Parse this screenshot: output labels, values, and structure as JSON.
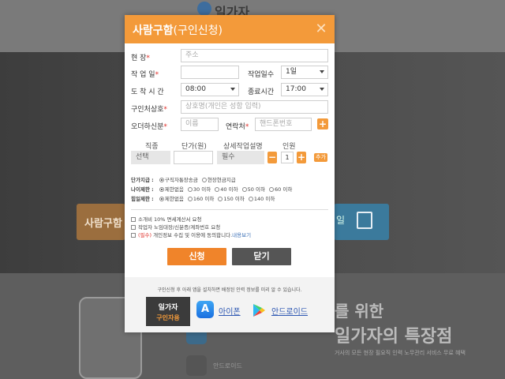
{
  "background": {
    "logo_text": "일가자",
    "left_button_text": "사람구함",
    "right_button_text": "일",
    "title_line1": "를 위한",
    "title_line2": "일가자의 특장점",
    "sub_text": "거사의 모든 현장 필요직 인력 노무관리 서비스 무료 혜택",
    "android_text": "안드로이드"
  },
  "modal": {
    "title_main": "사람구함",
    "title_paren": "(구인신청)",
    "fields": {
      "site_label": "현 장",
      "site_placeholder": "주소",
      "start_date_label": "작 업 일",
      "work_days_label": "작업일수",
      "work_days_value": "1일",
      "arrival_time_label": "도 착 시 간",
      "arrival_time_value": "08:00",
      "end_time_label": "종료시간",
      "end_time_value": "17:00",
      "company_label": "구인처상호",
      "company_placeholder": "상호명(개인은 성함 입력)",
      "contact_person_label": "오더하신분",
      "name_placeholder": "이름",
      "phone_label": "연락처",
      "phone_placeholder": "핸드폰번호"
    },
    "job_table": {
      "col_type": "직종",
      "col_price": "단가(원)",
      "col_desc": "상세작업설명",
      "col_people": "인원",
      "type_value": "선택",
      "desc_value": "필수",
      "people_value": "1",
      "add_label": "추가"
    },
    "radio_groups": {
      "pay": {
        "label": "단가지급 :",
        "options": [
          "구직자통장송금",
          "현장현금지급"
        ],
        "selected_index": 0
      },
      "age": {
        "label": "나이제한 :",
        "options": [
          "제한없음",
          "30 이하",
          "40 이하",
          "50 이하",
          "60 이하"
        ],
        "selected_index": 0
      },
      "weight": {
        "label": "힘일제한 :",
        "options": [
          "제한없음",
          "160 이하",
          "150 이하",
          "140 이하"
        ],
        "selected_index": 0
      }
    },
    "checkboxes": {
      "item1": "소개비 10% 면세계산서 요청",
      "item2": "작업자 노임대장/신분증/계좌번호 요청",
      "item3_prefix": "(필수)",
      "item3_text": " 개인정보 수집 및 이용에 동의합니다.",
      "item3_link": "내용보기"
    },
    "buttons": {
      "apply": "신청",
      "close": "닫기"
    },
    "footer": {
      "note": "구인신청 후 아래 앱을 설치하면 배정된 인력 정보를 미리 알 수 있습니다.",
      "brand_top": "일가자",
      "brand_bottom": "구인자용",
      "iphone_label": "아이폰",
      "android_label": "안드로이드"
    }
  },
  "colors": {
    "accent": "#f39a3a",
    "apply_button": "#f0842a",
    "close_button": "#555555",
    "link": "#2d57b2"
  }
}
